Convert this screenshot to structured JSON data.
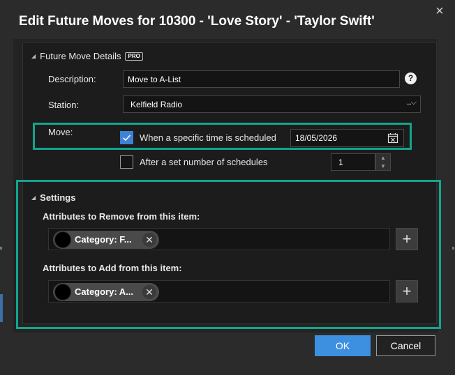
{
  "dialog": {
    "title": "Edit Future Moves for 10300 - 'Love Story' - 'Taylor Swift'",
    "close_glyph": "×"
  },
  "future_move": {
    "section_title": "Future Move Details",
    "pro_badge": "PRO",
    "description_label": "Description:",
    "description_value": "Move to A-List",
    "help_glyph": "?",
    "station_label": "Station:",
    "station_value": "Kelfield Radio",
    "move_label": "Move:",
    "option_scheduled_label": "When a specific time is scheduled",
    "option_scheduled_checked": true,
    "scheduled_date": "18/05/2026",
    "option_count_label": "After a set number of schedules",
    "option_count_checked": false,
    "schedule_count": "1"
  },
  "settings": {
    "section_title": "Settings",
    "remove_label": "Attributes to Remove from this item:",
    "remove_chip": "Category: F...",
    "add_label": "Attributes to Add from this item:",
    "add_chip": "Category: A...",
    "add_glyph": "+",
    "chip_remove_glyph": "✕"
  },
  "buttons": {
    "ok": "OK",
    "cancel": "Cancel"
  },
  "colors": {
    "accent_blue": "#3d8fe0",
    "highlight_teal": "#12a58c",
    "background": "#2b2b2b"
  }
}
